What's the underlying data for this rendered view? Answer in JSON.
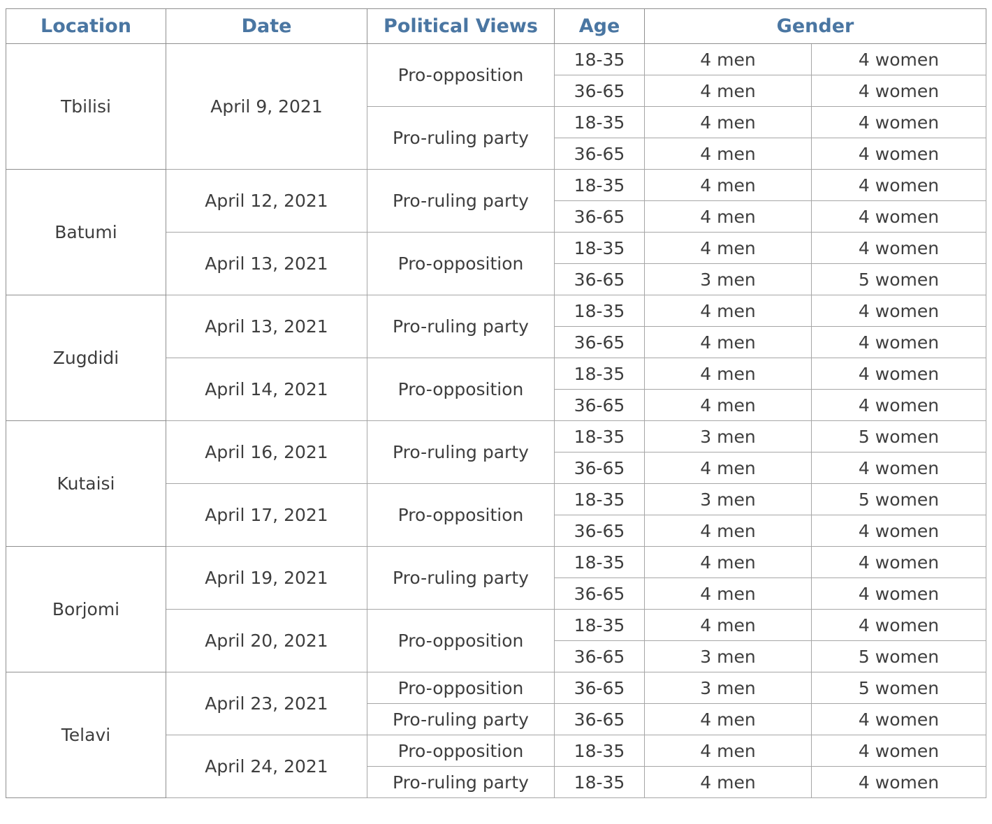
{
  "table": {
    "headers": {
      "location": "Location",
      "date": "Date",
      "political_views": "Political Views",
      "age": "Age",
      "gender": "Gender"
    },
    "rows": [
      {
        "location": "Tbilisi",
        "date": "April 9, 2021",
        "view": "Pro-opposition",
        "age": "18-35",
        "men": "4 men",
        "women": "4 women"
      },
      {
        "location": "Tbilisi",
        "date": "April 9, 2021",
        "view": "Pro-opposition",
        "age": "36-65",
        "men": "4 men",
        "women": "4 women"
      },
      {
        "location": "Tbilisi",
        "date": "April 9, 2021",
        "view": "Pro-ruling party",
        "age": "18-35",
        "men": "4 men",
        "women": "4 women"
      },
      {
        "location": "Tbilisi",
        "date": "April 9, 2021",
        "view": "Pro-ruling party",
        "age": "36-65",
        "men": "4 men",
        "women": "4 women"
      },
      {
        "location": "Batumi",
        "date": "April 12, 2021",
        "view": "Pro-ruling party",
        "age": "18-35",
        "men": "4 men",
        "women": "4 women"
      },
      {
        "location": "Batumi",
        "date": "April 12, 2021",
        "view": "Pro-ruling party",
        "age": "36-65",
        "men": "4 men",
        "women": "4 women"
      },
      {
        "location": "Batumi",
        "date": "April 13, 2021",
        "view": "Pro-opposition",
        "age": "18-35",
        "men": "4 men",
        "women": "4 women"
      },
      {
        "location": "Batumi",
        "date": "April 13, 2021",
        "view": "Pro-opposition",
        "age": "36-65",
        "men": "3 men",
        "women": "5 women"
      },
      {
        "location": "Zugdidi",
        "date": "April 13, 2021",
        "view": "Pro-ruling party",
        "age": "18-35",
        "men": "4 men",
        "women": "4 women"
      },
      {
        "location": "Zugdidi",
        "date": "April 13, 2021",
        "view": "Pro-ruling party",
        "age": "36-65",
        "men": "4 men",
        "women": "4 women"
      },
      {
        "location": "Zugdidi",
        "date": "April 14, 2021",
        "view": "Pro-opposition",
        "age": "18-35",
        "men": "4 men",
        "women": "4 women"
      },
      {
        "location": "Zugdidi",
        "date": "April 14, 2021",
        "view": "Pro-opposition",
        "age": "36-65",
        "men": "4 men",
        "women": "4 women"
      },
      {
        "location": "Kutaisi",
        "date": "April 16, 2021",
        "view": "Pro-ruling party",
        "age": "18-35",
        "men": "3 men",
        "women": "5 women"
      },
      {
        "location": "Kutaisi",
        "date": "April 16, 2021",
        "view": "Pro-ruling party",
        "age": "36-65",
        "men": "4 men",
        "women": "4 women"
      },
      {
        "location": "Kutaisi",
        "date": "April 17, 2021",
        "view": "Pro-opposition",
        "age": "18-35",
        "men": "3 men",
        "women": "5 women"
      },
      {
        "location": "Kutaisi",
        "date": "April 17, 2021",
        "view": "Pro-opposition",
        "age": "36-65",
        "men": "4 men",
        "women": "4 women"
      },
      {
        "location": "Borjomi",
        "date": "April 19, 2021",
        "view": "Pro-ruling party",
        "age": "18-35",
        "men": "4 men",
        "women": "4 women"
      },
      {
        "location": "Borjomi",
        "date": "April 19, 2021",
        "view": "Pro-ruling party",
        "age": "36-65",
        "men": "4 men",
        "women": "4 women"
      },
      {
        "location": "Borjomi",
        "date": "April 20, 2021",
        "view": "Pro-opposition",
        "age": "18-35",
        "men": "4 men",
        "women": "4 women"
      },
      {
        "location": "Borjomi",
        "date": "April 20, 2021",
        "view": "Pro-opposition",
        "age": "36-65",
        "men": "3 men",
        "women": "5 women"
      },
      {
        "location": "Telavi",
        "date": "April 23, 2021",
        "view": "Pro-opposition",
        "age": "36-65",
        "men": "3 men",
        "women": "5 women"
      },
      {
        "location": "Telavi",
        "date": "April 23, 2021",
        "view": "Pro-ruling party",
        "age": "36-65",
        "men": "4 men",
        "women": "4 women"
      },
      {
        "location": "Telavi",
        "date": "April 24, 2021",
        "view": "Pro-opposition",
        "age": "18-35",
        "men": "4 men",
        "women": "4 women"
      },
      {
        "location": "Telavi",
        "date": "April 24, 2021",
        "view": "Pro-ruling party",
        "age": "18-35",
        "men": "4 men",
        "women": "4 women"
      }
    ]
  },
  "colors": {
    "header_text": "#4a76a2",
    "body_text": "#3e3e3e",
    "border": "#a6a6a6"
  }
}
